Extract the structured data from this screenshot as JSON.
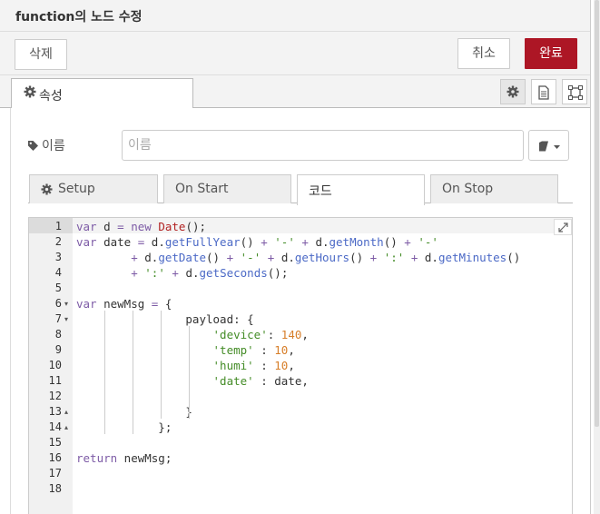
{
  "dialog": {
    "title": "function의 노드 수정"
  },
  "toolbar": {
    "delete_label": "삭제",
    "cancel_label": "취소",
    "done_label": "완료"
  },
  "tabs": {
    "properties_label": "속성",
    "icons": [
      "gear-icon",
      "document-icon",
      "frame-icon"
    ]
  },
  "name_field": {
    "label": "이름",
    "placeholder": "이름",
    "value": ""
  },
  "subtabs": [
    {
      "label": "Setup",
      "active": false
    },
    {
      "label": "On Start",
      "active": false
    },
    {
      "label": "코드",
      "active": true
    },
    {
      "label": "On Stop",
      "active": false
    }
  ],
  "editor": {
    "line_numbers": [
      "1",
      "2",
      "3",
      "4",
      "5",
      "6",
      "7",
      "8",
      "9",
      "10",
      "11",
      "12",
      "13",
      "14",
      "15",
      "16",
      "17",
      "18"
    ],
    "fold_markers": {
      "6": "▾",
      "7": "▾",
      "13": "▴",
      "14": "▴"
    },
    "lines": [
      "var d = new Date();",
      "var date = d.getFullYear() + '-' + d.getMonth() + '-'",
      "        + d.getDate() + '-' + d.getHours() + ':' + d.getMinutes()",
      "        + ':' + d.getSeconds();",
      "",
      "var newMsg = {",
      "                payload: {",
      "                    'device': 140,",
      "                    'temp' : 10,",
      "                    'humi' : 10,",
      "                    'date' : date,",
      "",
      "                }",
      "            };",
      "",
      "return newMsg;",
      "",
      ""
    ]
  },
  "colors": {
    "accent": "#ad1625",
    "keyword": "#7d5ba6",
    "function": "#4b69c6",
    "string": "#448c27",
    "number": "#d77e29"
  }
}
